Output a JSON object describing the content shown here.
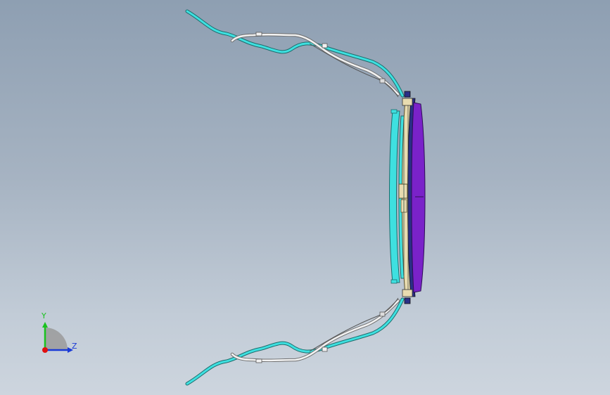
{
  "viewport": {
    "background_top": "#8e9fb2",
    "background_bottom": "#cdd5de"
  },
  "model": {
    "parts": [
      {
        "name": "cable-harness-cyan",
        "color": "#3ee0e0"
      },
      {
        "name": "cable-harness-white",
        "color": "#f2f2f2"
      },
      {
        "name": "frame-beige",
        "color": "#e8dcb0"
      },
      {
        "name": "panel-purple",
        "color": "#7a22c9"
      },
      {
        "name": "panel-dark-blue",
        "color": "#2b2f86"
      }
    ]
  },
  "triad": {
    "y_label": "Y",
    "z_label": "Z",
    "y_color": "#19c21e",
    "z_color": "#1a3ad6",
    "x_color": "#e01010"
  }
}
